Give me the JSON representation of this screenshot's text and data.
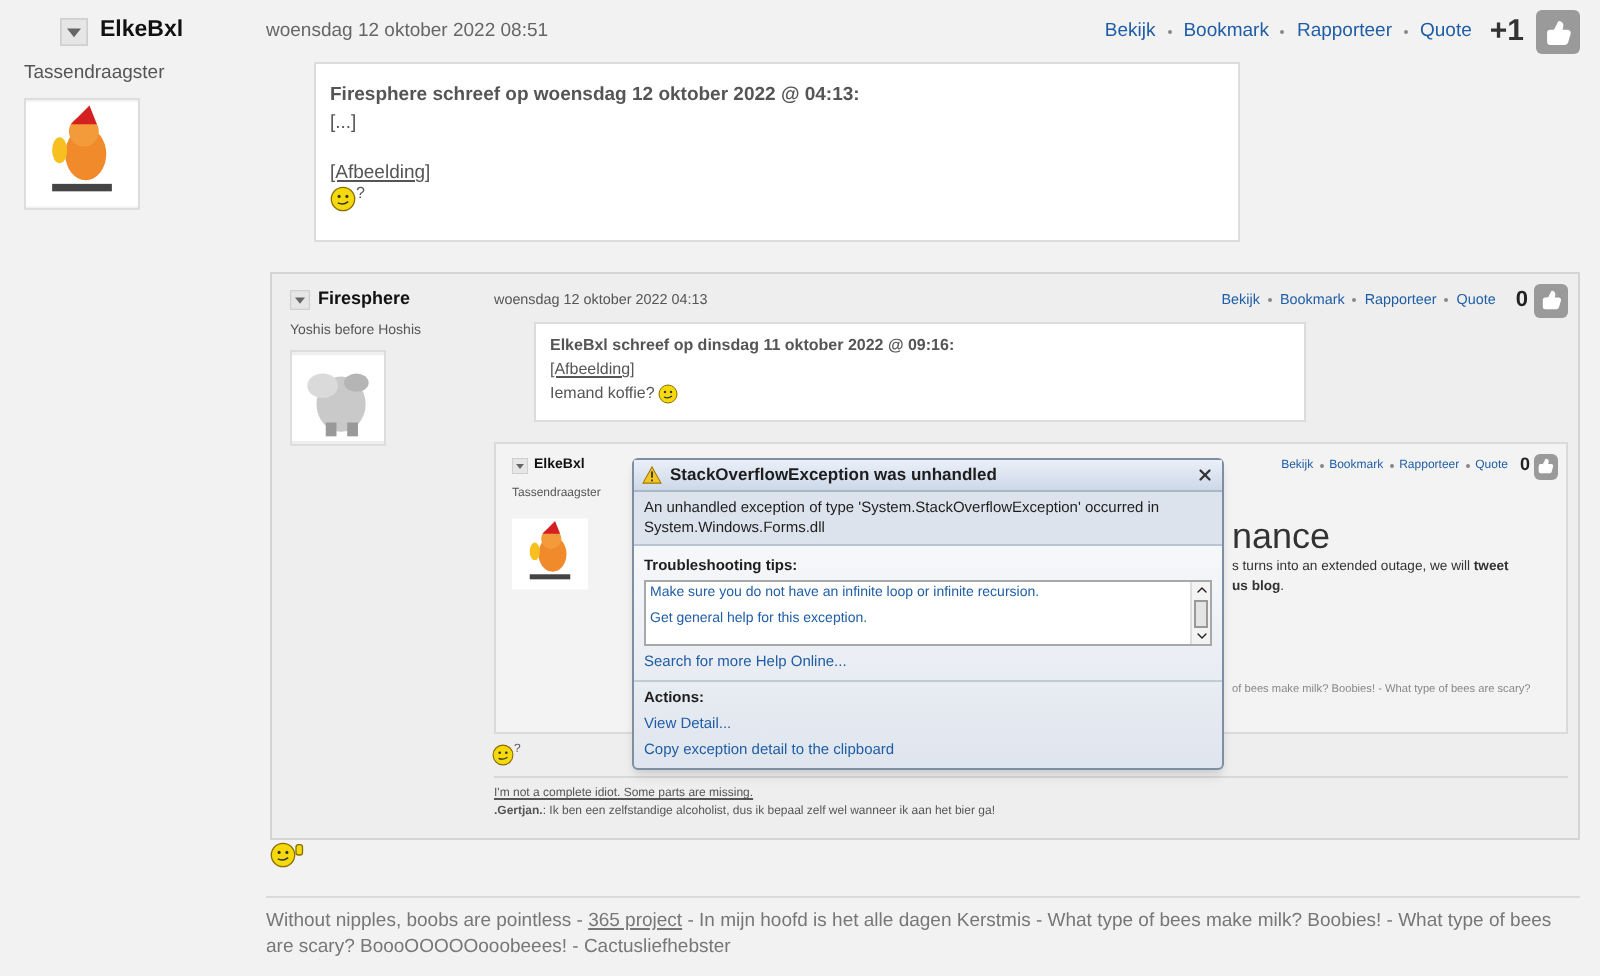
{
  "post": {
    "author": "ElkeBxl",
    "rank": "Tassendraagster",
    "date": "woensdag 12 oktober 2022 08:51",
    "actions": [
      "Bekijk",
      "Bookmark",
      "Rapporteer",
      "Quote"
    ],
    "score": "+1",
    "quote": {
      "header": "Firesphere schreef op woensdag 12 oktober 2022 @ 04:13:",
      "lines": [
        {
          "kind": "text",
          "text": "[...]"
        },
        {
          "kind": "gap"
        },
        {
          "kind": "link",
          "text": "[Afbeelding]"
        },
        {
          "kind": "smiley",
          "suffix": "?"
        }
      ]
    }
  },
  "screenshot": {
    "post": {
      "author": "Firesphere",
      "rank": "Yoshis before Hoshis",
      "date": "woensdag 12 oktober 2022 04:13",
      "actions": [
        "Bekijk",
        "Bookmark",
        "Rapporteer",
        "Quote"
      ],
      "score": "0",
      "quote": {
        "header": "ElkeBxl schreef op dinsdag 11 oktober 2022 @ 09:16:",
        "lines": [
          {
            "kind": "link",
            "text": "[Afbeelding]"
          },
          {
            "kind": "text_smiley",
            "text": "Iemand koffie?"
          }
        ]
      }
    },
    "nested_post": {
      "author": "ElkeBxl",
      "rank": "Tassendraagster",
      "actions": [
        "Bekijk",
        "Bookmark",
        "Rapporteer",
        "Quote"
      ],
      "score": "0",
      "fragments": [
        {
          "kind": "heading",
          "text": "nance"
        },
        {
          "kind": "text",
          "text": "s turns into an extended outage, we will **tweet**"
        },
        {
          "kind": "text",
          "text": "**us blog**."
        },
        {
          "kind": "signature",
          "text": "of bees make milk? Boobies! - What type of bees are scary?"
        }
      ]
    },
    "smiley_suffix": "?",
    "signature": [
      {
        "kind": "link",
        "text": "I'm not a complete idiot. Some parts are missing."
      },
      {
        "kind": "text",
        "text": "**.Gertjan.**: Ik ben een zelfstandige alcoholist, dus ik bepaal zelf wel wanneer ik aan het bier ga!"
      }
    ],
    "dialog": {
      "title": "StackOverflowException was unhandled",
      "message": "An unhandled exception of type 'System.StackOverflowException' occurred in System.Windows.Forms.dll",
      "tips_heading": "Troubleshooting tips:",
      "tips": [
        "Make sure you do not have an infinite loop or infinite recursion.",
        "Get general help for this exception."
      ],
      "help_link": "Search for more Help Online...",
      "actions_heading": "Actions:",
      "actions": [
        "View Detail...",
        "Copy exception detail to the clipboard"
      ]
    }
  },
  "signature": [
    {
      "kind": "text",
      "text": "Without nipples, boobs are pointless - "
    },
    {
      "kind": "link",
      "text": "365 project"
    },
    {
      "kind": "text",
      "text": " - In mijn hoofd is het alle dagen Kerstmis - What type of bees make milk? Boobies! - What type of bees are scary? BoooOOOOOooobeees! - Cactusliefhebster"
    }
  ]
}
